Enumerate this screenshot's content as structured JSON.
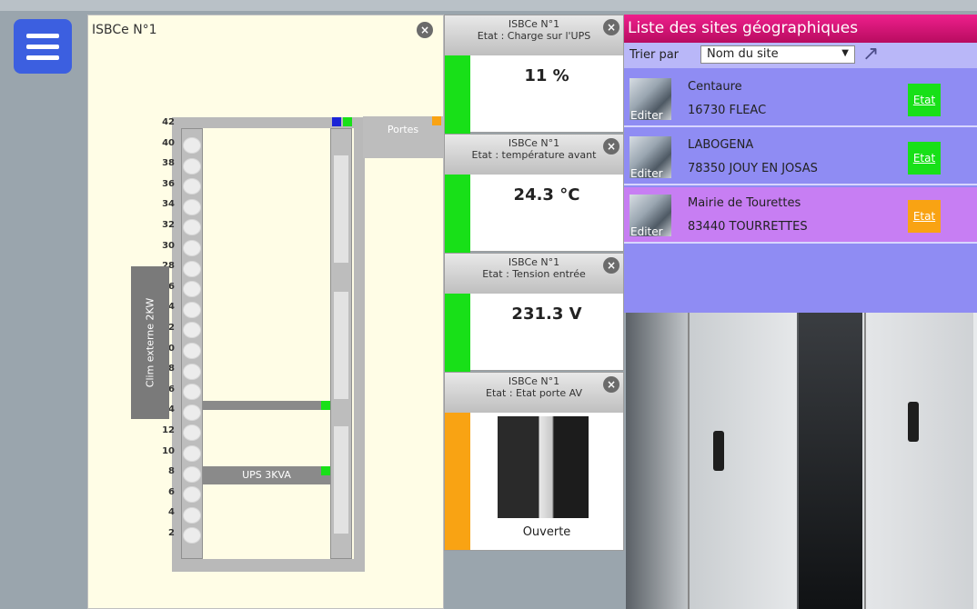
{
  "rack": {
    "title": "ISBCe N°1",
    "close": "×",
    "numbers": [
      "42",
      "40",
      "38",
      "36",
      "34",
      "32",
      "30",
      "28",
      "26",
      "24",
      "22",
      "20",
      "18",
      "16",
      "14",
      "12",
      "10",
      "8",
      "6",
      "4",
      "2"
    ],
    "devices": [
      {
        "label": "",
        "led": "#18e018"
      },
      {
        "label": "UPS 3KVA",
        "led": "#18e018"
      }
    ],
    "portes_label": "Portes",
    "clim_label": "Clim externe 2KW",
    "top_leds": [
      "#1a24d6",
      "#18e018"
    ],
    "portes_led": "#f9a313"
  },
  "cards": [
    {
      "site": "ISBCe N°1",
      "state": "Etat : Charge sur l'UPS",
      "value": "11 %",
      "color": "#18e018"
    },
    {
      "site": "ISBCe N°1",
      "state": "Etat : température avant",
      "value": "24.3 °C",
      "color": "#18e018"
    },
    {
      "site": "ISBCe N°1",
      "state": "Etat : Tension entrée",
      "value": "231.3 V",
      "color": "#18e018"
    },
    {
      "site": "ISBCe N°1",
      "state": "Etat : Etat porte AV",
      "value": "Ouverte",
      "color": "#f9a313"
    }
  ],
  "sites": {
    "title": "Liste des sites géographiques",
    "sort_label": "Trier par",
    "sort_value": "Nom du site",
    "items": [
      {
        "name": "Centaure",
        "address": "16730  FLEAC",
        "edit": "Editer",
        "state": "Etat",
        "state_color": "#18e018",
        "bg": "#8f8cf3"
      },
      {
        "name": "LABOGENA",
        "address": "78350  JOUY EN JOSAS",
        "edit": "Editer",
        "state": "Etat",
        "state_color": "#18e018",
        "bg": "#8f8cf3"
      },
      {
        "name": "Mairie de Tourettes",
        "address": "83440  TOURRETTES",
        "edit": "Editer",
        "state": "Etat",
        "state_color": "#f9a313",
        "bg": "#c77ef3"
      }
    ]
  }
}
